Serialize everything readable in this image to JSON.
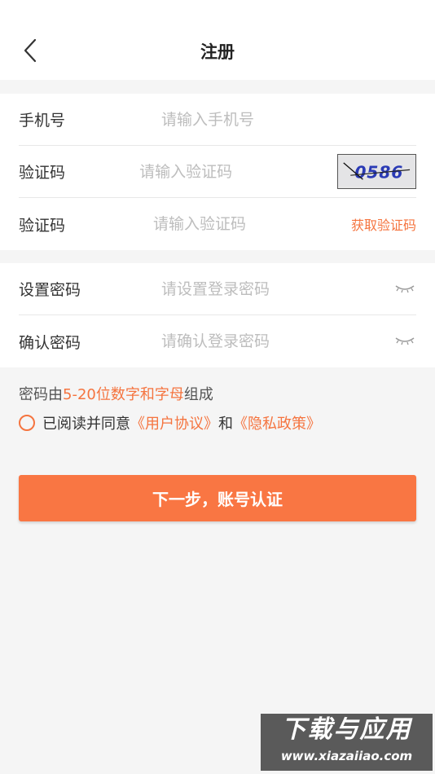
{
  "header": {
    "title": "注册",
    "back_icon": "chevron-left-icon"
  },
  "form": {
    "phone": {
      "label": "手机号",
      "placeholder": "请输入手机号"
    },
    "captcha": {
      "label": "验证码",
      "placeholder": "请输入验证码",
      "image_text": "0586"
    },
    "sms": {
      "label": "验证码",
      "placeholder": "请输入验证码",
      "get_code": "获取验证码"
    },
    "password": {
      "label": "设置密码",
      "placeholder": "请设置登录密码",
      "icon": "eye-closed-icon"
    },
    "confirm": {
      "label": "确认密码",
      "placeholder": "请确认登录密码",
      "icon": "eye-closed-icon"
    }
  },
  "hint": {
    "prefix": "密码由",
    "accent": "5-20位数字和字母",
    "suffix": "组成"
  },
  "agreement": {
    "prefix": "已阅读并同意",
    "user_agreement": "《用户协议》",
    "and": "和",
    "privacy_policy": "《隐私政策》"
  },
  "next_button": "下一步，账号认证",
  "watermark": {
    "main": "下载与应用",
    "url": "www.xiazaiiao.com"
  },
  "colors": {
    "accent": "#f5743f",
    "button": "#f97643",
    "background": "#f5f5f5"
  }
}
